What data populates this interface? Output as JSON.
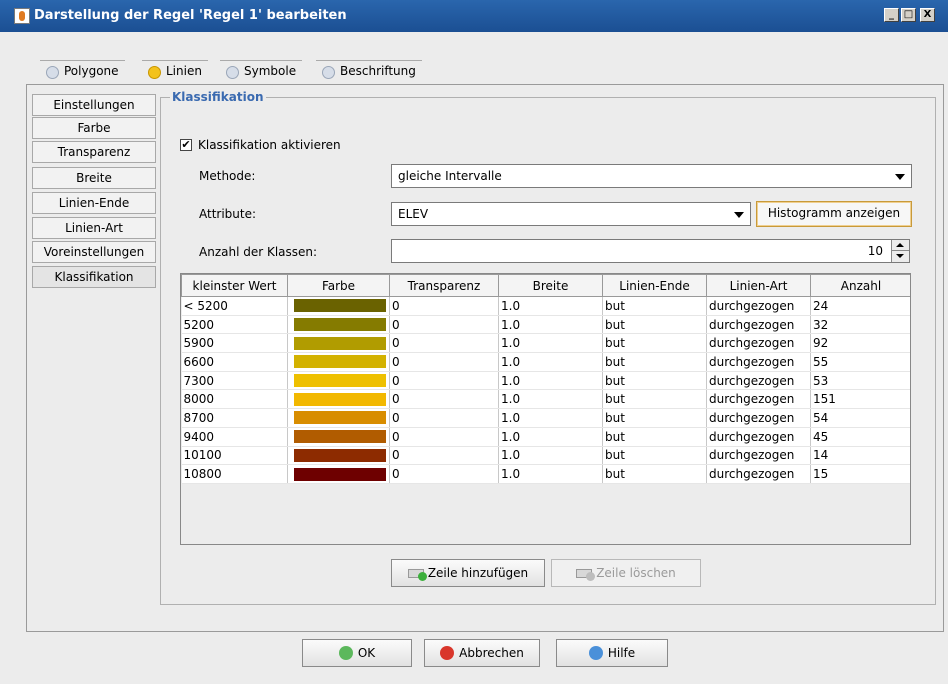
{
  "window": {
    "title": "Darstellung der Regel 'Regel 1' bearbeiten",
    "min": "_",
    "max": "□",
    "close": "X"
  },
  "tabs": [
    {
      "label": "Polygone",
      "icon": "bulb-icon"
    },
    {
      "label": "Linien",
      "icon": "bulb-icon"
    },
    {
      "label": "Symbole",
      "icon": "bulb-icon"
    },
    {
      "label": "Beschriftung",
      "icon": "bulb-icon"
    }
  ],
  "side_items": [
    "Einstellungen",
    "Farbe",
    "Transparenz",
    "Breite",
    "Linien-Ende",
    "Linien-Art",
    "Voreinstellungen",
    "Klassifikation"
  ],
  "panel": {
    "legend": "Klassifikation",
    "checkbox_label": "Klassifikation aktivieren",
    "checkbox_mark": "✔",
    "method_label": "Methode:",
    "method_value": "gleiche Intervalle",
    "attribute_label": "Attribute:",
    "attribute_value": "ELEV",
    "histogram_button": "Histogramm anzeigen",
    "classes_label": "Anzahl der Klassen:",
    "classes_value": "10"
  },
  "table": {
    "headers": [
      "kleinster Wert",
      "Farbe",
      "Transparenz",
      "Breite",
      "Linien-Ende",
      "Linien-Art",
      "Anzahl"
    ],
    "rows": [
      {
        "min": "< 5200",
        "color": "#6a6200",
        "transparency": "0",
        "width": "1.0",
        "end": "but",
        "style": "durchgezogen",
        "count": "24"
      },
      {
        "min": "5200",
        "color": "#857b00",
        "transparency": "0",
        "width": "1.0",
        "end": "but",
        "style": "durchgezogen",
        "count": "32"
      },
      {
        "min": "5900",
        "color": "#b19c00",
        "transparency": "0",
        "width": "1.0",
        "end": "but",
        "style": "durchgezogen",
        "count": "92"
      },
      {
        "min": "6600",
        "color": "#d3b200",
        "transparency": "0",
        "width": "1.0",
        "end": "but",
        "style": "durchgezogen",
        "count": "55"
      },
      {
        "min": "7300",
        "color": "#eec000",
        "transparency": "0",
        "width": "1.0",
        "end": "but",
        "style": "durchgezogen",
        "count": "53"
      },
      {
        "min": "8000",
        "color": "#f2b800",
        "transparency": "0",
        "width": "1.0",
        "end": "but",
        "style": "durchgezogen",
        "count": "151"
      },
      {
        "min": "8700",
        "color": "#d88d00",
        "transparency": "0",
        "width": "1.0",
        "end": "but",
        "style": "durchgezogen",
        "count": "54"
      },
      {
        "min": "9400",
        "color": "#b15c00",
        "transparency": "0",
        "width": "1.0",
        "end": "but",
        "style": "durchgezogen",
        "count": "45"
      },
      {
        "min": "10100",
        "color": "#8d2b00",
        "transparency": "0",
        "width": "1.0",
        "end": "but",
        "style": "durchgezogen",
        "count": "14"
      },
      {
        "min": "10800",
        "color": "#6e0000",
        "transparency": "0",
        "width": "1.0",
        "end": "but",
        "style": "durchgezogen",
        "count": "15"
      }
    ]
  },
  "row_buttons": {
    "add": "Zeile hinzufügen",
    "delete": "Zeile löschen"
  },
  "footer": {
    "ok": "OK",
    "cancel": "Abbrechen",
    "help": "Hilfe"
  }
}
